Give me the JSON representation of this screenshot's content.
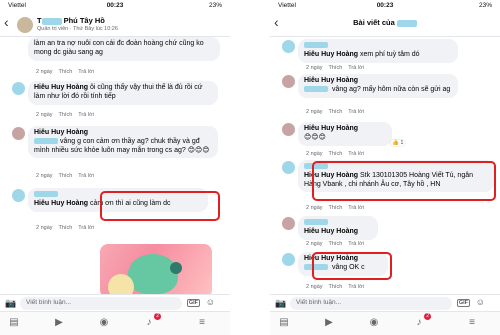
{
  "left": {
    "status": {
      "carrier": "Viettel",
      "time": "00:23",
      "battery": "23%"
    },
    "header": {
      "name": "Phú Tây Hồ",
      "name_prefix": "T",
      "subtitle": "Quản trị viên · Thứ Bảy lúc 10:26"
    },
    "comments": [
      {
        "text": "làm an tra nợ nuôi con cái đc đoàn hoàng chứ cũng ko mong dc giàu sang ag",
        "time": "2 ngày",
        "like": "Thích",
        "reply": "Trả lời"
      },
      {
        "mention": "Hiêu Huy Hoàng",
        "text": " ôi cũng thấy vậy thui thế là đủ rồi cứ làm như lời đó rồi tính tiếp",
        "time": "2 ngày",
        "like": "Thích",
        "reply": "Trả lời"
      },
      {
        "author": "Hiêu Huy Hoàng",
        "text": "vâng g con cảm ơn thầy ag? chuk thầy và gđ mình nhiều sức khỏe luôn may mắn trong cs ag? 😊😊😊",
        "time": "2 ngày",
        "like": "Thích",
        "reply": "Trả lời"
      },
      {
        "mention": "Hiêu Huy Hoàng",
        "text": " cảm ơn thì ai cũng làm dc",
        "time": "2 ngày",
        "like": "Thích",
        "reply": "Trả lời"
      }
    ],
    "composer_placeholder": "Viết bình luận...",
    "gif_label": "GIF",
    "notif_count": "2"
  },
  "right": {
    "status": {
      "carrier": "Viettel",
      "time": "00:23",
      "battery": "23%"
    },
    "header": {
      "title": "Bài viết của"
    },
    "comments": [
      {
        "mention": "Hiêu Huy Hoàng",
        "text": " xem phí tuỳ tâm dó",
        "time": "2 ngày",
        "like": "Thích",
        "reply": "Trả lời"
      },
      {
        "author": "Hiêu Huy Hoàng",
        "mention": "",
        "text": " vâng ag? mấy hôm nữa còn sẽ gửi ag",
        "time": "2 ngày",
        "like": "Thích",
        "reply": "Trả lời"
      },
      {
        "author": "Hiêu Huy Hoàng",
        "text": "😊😊😊",
        "time": "2 ngày",
        "like": "Thích",
        "reply": "Trả lời",
        "reaction": "1"
      },
      {
        "mention": "Hiêu Huy Hoàng",
        "text": " Stk 130101305 Hoàng Viết Tú, ngân Hàng Vbank , chi nhánh Âu cơ, Tây hồ , HN",
        "time": "2 ngày",
        "like": "Thích",
        "reply": "Trả lời"
      },
      {
        "author": "Hiêu Huy Hoàng",
        "text": "",
        "time": "2 ngày",
        "like": "Thích",
        "reply": "Trả lời"
      },
      {
        "mention": "Hiêu Huy Hoàng",
        "text": " vâng OK c",
        "time": "2 ngày",
        "like": "Thích",
        "reply": "Trả lời"
      }
    ],
    "composer_placeholder": "Viết bình luận...",
    "gif_label": "GIF",
    "notif_count": "2"
  },
  "colors": {
    "highlight": "#e02020",
    "bubble": "#f0f2f5",
    "badge": "#e41e3f"
  }
}
